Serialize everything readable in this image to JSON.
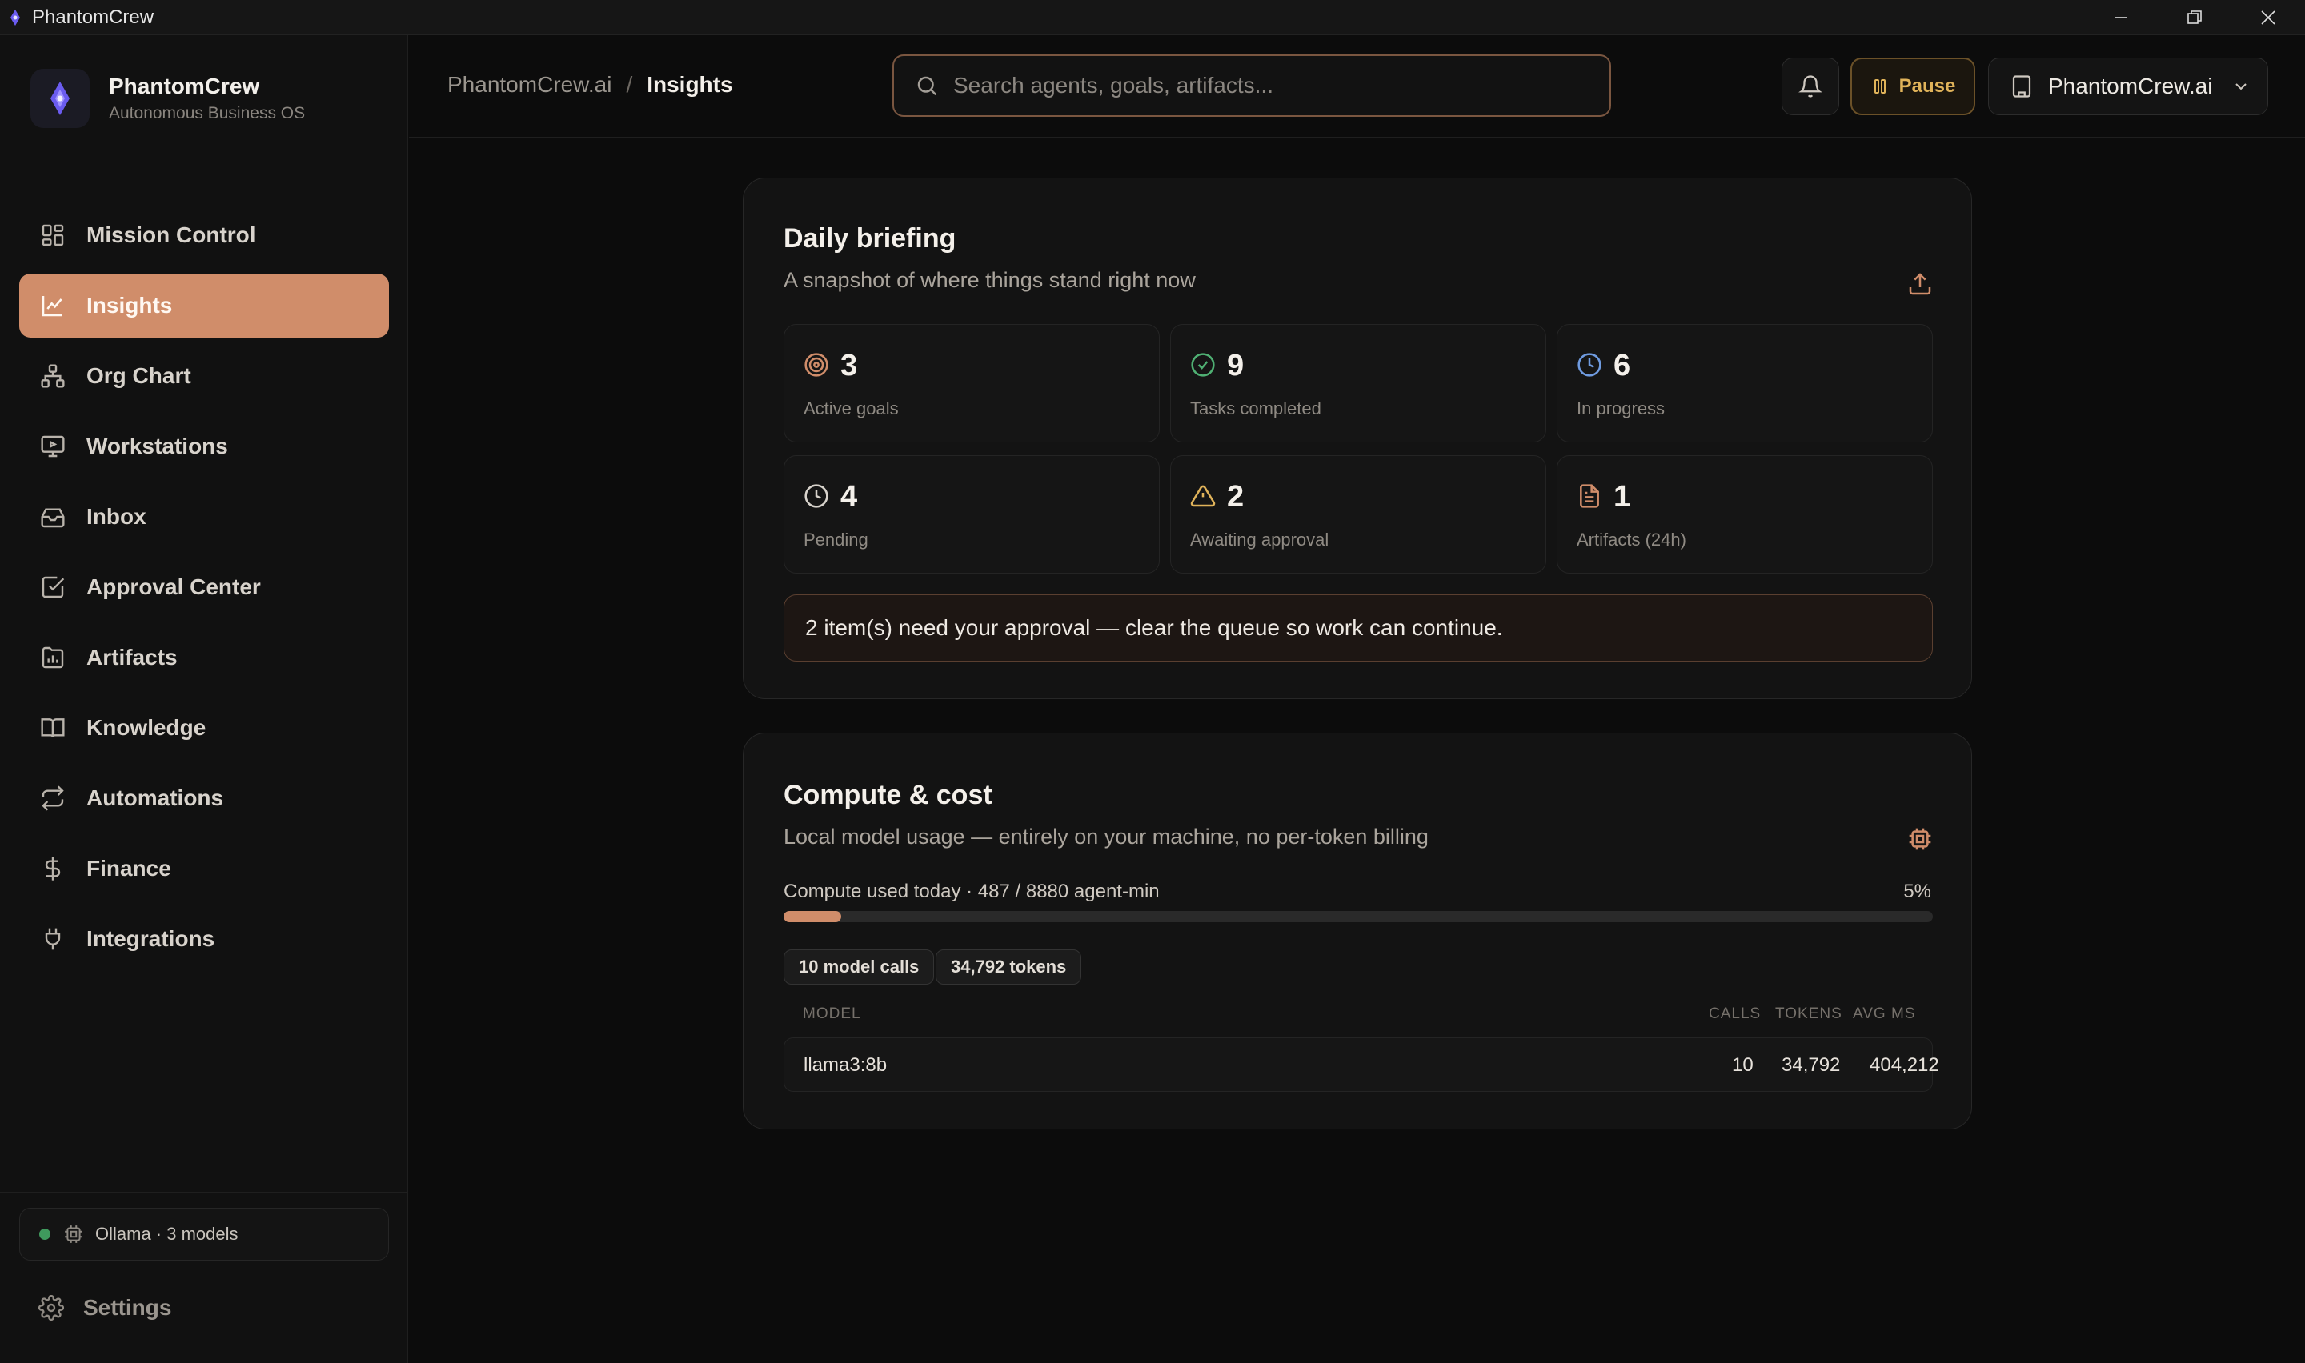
{
  "window": {
    "title": "PhantomCrew"
  },
  "brand": {
    "name": "PhantomCrew",
    "subtitle": "Autonomous Business OS"
  },
  "sidebar": {
    "items": [
      {
        "label": "Mission Control",
        "icon": "grid-icon",
        "active": false
      },
      {
        "label": "Insights",
        "icon": "chart-line-icon",
        "active": true
      },
      {
        "label": "Org Chart",
        "icon": "org-chart-icon",
        "active": false
      },
      {
        "label": "Workstations",
        "icon": "monitor-icon",
        "active": false
      },
      {
        "label": "Inbox",
        "icon": "inbox-icon",
        "active": false
      },
      {
        "label": "Approval Center",
        "icon": "checkbox-icon",
        "active": false
      },
      {
        "label": "Artifacts",
        "icon": "folder-chart-icon",
        "active": false
      },
      {
        "label": "Knowledge",
        "icon": "book-icon",
        "active": false
      },
      {
        "label": "Automations",
        "icon": "repeat-icon",
        "active": false
      },
      {
        "label": "Finance",
        "icon": "dollar-icon",
        "active": false
      },
      {
        "label": "Integrations",
        "icon": "plug-icon",
        "active": false
      }
    ],
    "status": "Ollama · 3 models",
    "settings_label": "Settings"
  },
  "header": {
    "breadcrumb_root": "PhantomCrew.ai",
    "breadcrumb_sep": "/",
    "breadcrumb_current": "Insights",
    "search_placeholder": "Search agents, goals, artifacts...",
    "pause_label": "Pause",
    "workspace_label": "PhantomCrew.ai"
  },
  "briefing": {
    "title": "Daily briefing",
    "subtitle": "A snapshot of where things stand right now",
    "stats": [
      {
        "value": "3",
        "label": "Active goals",
        "icon": "target-icon"
      },
      {
        "value": "9",
        "label": "Tasks completed",
        "icon": "check-circle-icon"
      },
      {
        "value": "6",
        "label": "In progress",
        "icon": "clock-icon"
      },
      {
        "value": "4",
        "label": "Pending",
        "icon": "clock-icon"
      },
      {
        "value": "2",
        "label": "Awaiting approval",
        "icon": "warning-icon"
      },
      {
        "value": "1",
        "label": "Artifacts (24h)",
        "icon": "document-icon"
      }
    ],
    "approval_message": "2 item(s) need your approval — clear the queue so work can continue."
  },
  "compute": {
    "title": "Compute & cost",
    "subtitle": "Local model usage — entirely on your machine, no per-token billing",
    "usage_label": "Compute used today · 487 / 8880 agent-min",
    "usage_percent_label": "5%",
    "usage_fraction": 0.05,
    "chips": [
      "10 model calls",
      "34,792 tokens"
    ],
    "table": {
      "headers": [
        "MODEL",
        "CALLS",
        "TOKENS",
        "AVG MS"
      ],
      "rows": [
        {
          "model": "llama3:8b",
          "calls": "10",
          "tokens": "34,792",
          "avg_ms": "404,212"
        }
      ]
    }
  },
  "colors": {
    "accent": "#d08d6a",
    "warning": "#e0b35a",
    "success": "#3f9a5d"
  }
}
